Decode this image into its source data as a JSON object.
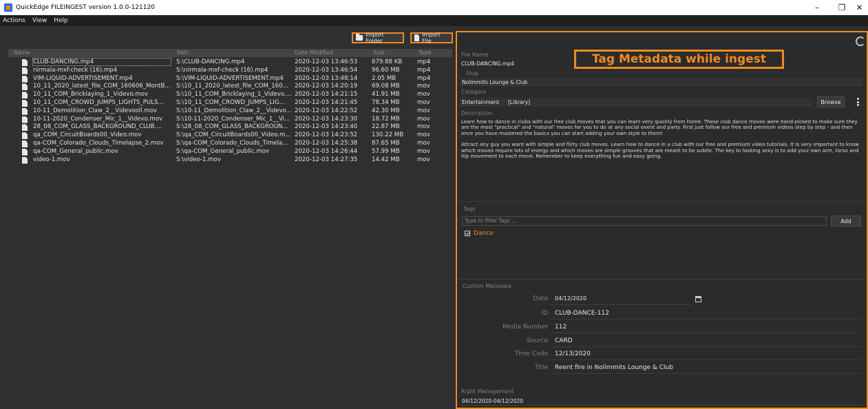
{
  "window": {
    "title": "QuickEdge FILEINGEST version 1.0.0-121120",
    "minimize": "–",
    "maximize": "❐",
    "close": "✕"
  },
  "menu": [
    "Actions",
    "View",
    "Help"
  ],
  "toolbar": {
    "import_folder": "Import Folder",
    "import_file": "Import File"
  },
  "file_table": {
    "columns": [
      "Name",
      "Path",
      "Date Modified",
      "Size",
      "Type"
    ],
    "rows": [
      {
        "name": "CLUB-DANCING.mp4",
        "path": "S:\\CLUB-DANCING.mp4",
        "date": "2020-12-03 13:46:53",
        "size": "879.88 KB",
        "type": "mp4"
      },
      {
        "name": "nirmala-mxf-check (16).mp4",
        "path": "S:\\nirmala-mxf-check (16).mp4",
        "date": "2020-12-03 13:46:54",
        "size": "96.60 MB",
        "type": "mp4"
      },
      {
        "name": "VIM-LIQUID-ADVERTISEMENT.mp4",
        "path": "S:\\VIM-LIQUID-ADVERTISEMENT.mp4",
        "date": "2020-12-03 13:48:14",
        "size": "2.05 MB",
        "type": "mp4"
      },
      {
        "name": "10_11_2020_latest_file_COM_160606_MontB...",
        "path": "S:\\10_11_2020_latest_file_COM_160...",
        "date": "2020-12-03 14:20:19",
        "size": "69.08 MB",
        "type": "mov"
      },
      {
        "name": "10_11_COM_Bricklaying_1_Videvo.mov",
        "path": "S:\\10_11_COM_Bricklaying_1_Videvo....",
        "date": "2020-12-03 14:21:15",
        "size": "41.91 MB",
        "type": "mov"
      },
      {
        "name": "10_11_COM_CROWD_JUMPS_LIGHTS_PULS...",
        "path": "S:\\10_11_COM_CROWD_JUMPS_LIG...",
        "date": "2020-12-03 14:21:45",
        "size": "78.34 MB",
        "type": "mov"
      },
      {
        "name": "10-11_Demolition_Claw_2__Videvooll.mov",
        "path": "S:\\10-11_Demolition_Claw_2__Videvo...",
        "date": "2020-12-03 14:22:52",
        "size": "42.30 MB",
        "type": "mov"
      },
      {
        "name": "10-11-2020_Condenser_Mic_1__Videvo.mov",
        "path": "S:\\10-11-2020_Condenser_Mic_1__Vi...",
        "date": "2020-12-03 14:23:30",
        "size": "18.72 MB",
        "type": "mov"
      },
      {
        "name": "28_08_COM_GLASS_BACKGROUND_CLUB....",
        "path": "S:\\28_08_COM_GLASS_BACKGROUN...",
        "date": "2020-12-03 14:23:40",
        "size": "22.87 MB",
        "type": "mov"
      },
      {
        "name": "qa_COM_CircuitBoards00_Video.mov",
        "path": "S:\\qa_COM_CircuitBoards00_Video.m...",
        "date": "2020-12-03 14:23:52",
        "size": "130.22 MB",
        "type": "mov"
      },
      {
        "name": "qa-COM_Colorado_Clouds_Timelapse_2.mov",
        "path": "S:\\qa-COM_Colorado_Clouds_Timela...",
        "date": "2020-12-03 14:25:38",
        "size": "87.65 MB",
        "type": "mov"
      },
      {
        "name": "qa-COM_General_public.mov",
        "path": "S:\\qa-COM_General_public.mov",
        "date": "2020-12-03 14:26:44",
        "size": "57.99 MB",
        "type": "mov"
      },
      {
        "name": "video-1.mov",
        "path": "S:\\video-1.mov",
        "date": "2020-12-03 14:27:35",
        "size": "14.42 MB",
        "type": "mov"
      }
    ]
  },
  "metadata": {
    "banner": "Tag Metadata while ingest",
    "file_name_label": "File Name",
    "file_name": "CLUB-DANCING.mp4",
    "slug_label": "Slug",
    "slug": "Nolimmits Lounge & Club",
    "category_label": "Category",
    "category": "Entertainment",
    "category_lib": "[Library]",
    "browse": "Browse",
    "description_label": "Description",
    "description_p1": "Learn how to dance in clubs with our free club moves that you can learn very quickly from home. These club dance moves were hand-picked to make sure they are the most \"practical\" and \"natural\" moves for you to do at any social event and party. First just follow our free and premium videos step by step - and then once you have mastered the basics you can start adding your own style to them!",
    "description_p2": "Attract any guy you want with simple and flirty club moves. Learn how to dance in a club with our free and premium video tutorials. It is very important to know which moves require lots of energy and which moves are simple grooves that are meant to be subtle. The key to looking sexy is to add your own arm, torso and hip movement to each move. Remember to keep everything fun and easy going.",
    "tags_label": "Tags",
    "tags_placeholder": "Type to filter Tags ...",
    "add": "Add",
    "tags": [
      "Dance"
    ],
    "custom_label": "Custom Metadata",
    "custom": [
      {
        "key": "Date",
        "value": "04/12/2020"
      },
      {
        "key": "ID",
        "value": "CLUB-DANCE-112"
      },
      {
        "key": "Media Number",
        "value": "112"
      },
      {
        "key": "Source",
        "value": "CARD"
      },
      {
        "key": "Time Code",
        "value": "12/13/2020"
      },
      {
        "key": "Title",
        "value": "Reent fire in Nolimmits Lounge & Club"
      }
    ],
    "rights_label": "Right Management",
    "rights": "04/12/2020-04/12/2020"
  },
  "colors": {
    "accent": "#f08a24",
    "background": "#2f2f2f",
    "panel": "#2b2b2b"
  }
}
